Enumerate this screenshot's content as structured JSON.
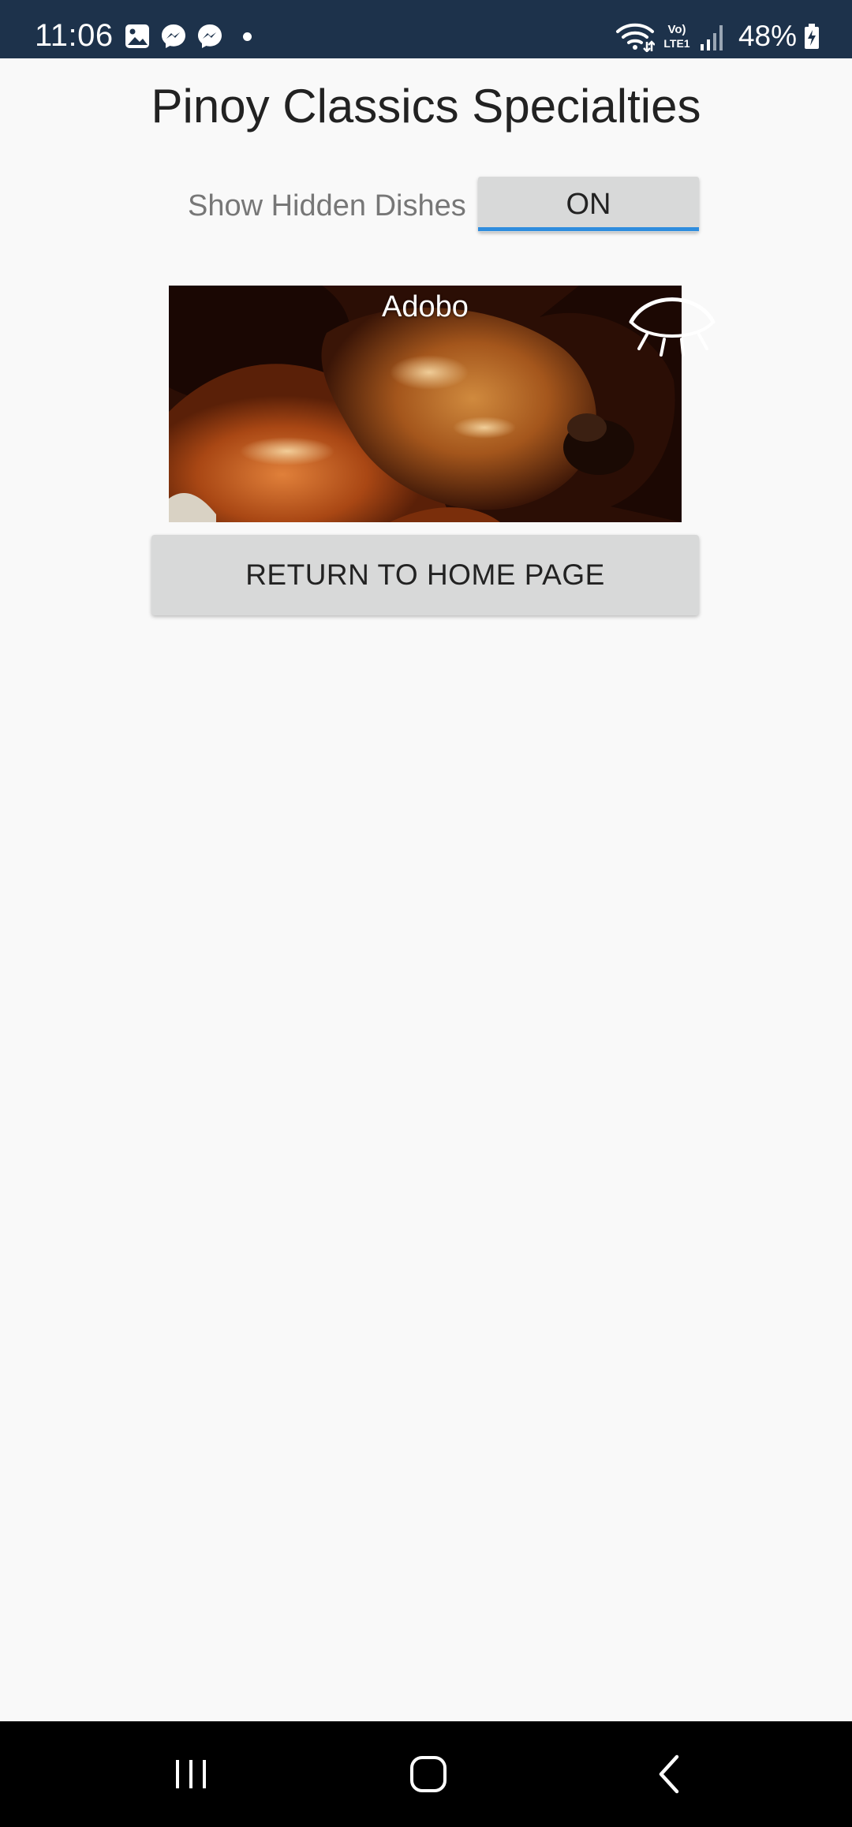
{
  "status_bar": {
    "time": "11:06",
    "battery": "48%",
    "left_icons": [
      "gallery-icon",
      "messenger-icon",
      "messenger-icon",
      "notification-dot"
    ],
    "right_icons": [
      "wifi-icon",
      "volte-icon",
      "signal-icon",
      "battery-charging-icon"
    ],
    "volte_label_top": "Vo)",
    "volte_label_bottom": "LTE1",
    "background": "#1d324b"
  },
  "page": {
    "title": "Pinoy Classics Specialties",
    "toggle": {
      "label": "Show Hidden Dishes",
      "state": "ON",
      "accent": "#2f8dde"
    },
    "dishes": [
      {
        "name": "Adobo",
        "icon": "eye-icon"
      }
    ],
    "home_button_label": "RETURN TO HOME PAGE"
  },
  "nav_bar": {
    "buttons": [
      "recent-apps-icon",
      "home-icon",
      "back-icon"
    ]
  }
}
